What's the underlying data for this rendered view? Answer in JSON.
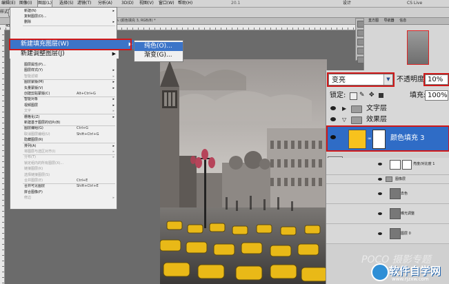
{
  "menubar": {
    "items": [
      "编辑(E)",
      "图像(I)",
      "图层(L)",
      "选择(S)",
      "滤镜(T)",
      "分析(A)",
      "3D(D)",
      "视图(V)",
      "窗口(W)",
      "帮助(H)"
    ],
    "zoom": "20.1",
    "workspace": "设计",
    "cslive": "CS Live"
  },
  "optionbar": {
    "label": "样式:",
    "style_value": "细"
  },
  "doc_tab": "@ 20.1% (颜色填充 3, RGB/8) *",
  "ruler_nums": [
    "40",
    "6"
  ],
  "layer_menu": {
    "items": [
      {
        "label": "新建(N)",
        "key": "",
        "arrow": true,
        "disabled": false
      },
      {
        "label": "复制图层(D)...",
        "key": "",
        "arrow": false,
        "disabled": false
      },
      {
        "label": "删除",
        "key": "",
        "arrow": true,
        "disabled": false
      },
      {
        "label": "图层属性(P)...",
        "key": "",
        "arrow": false,
        "disabled": false
      },
      {
        "label": "图层样式(Y)",
        "key": "",
        "arrow": true,
        "disabled": false
      },
      {
        "label": "智能滤镜",
        "key": "",
        "arrow": true,
        "disabled": true
      },
      {
        "label": "图层蒙版(M)",
        "key": "",
        "arrow": true,
        "disabled": false
      },
      {
        "label": "矢量蒙版(V)",
        "key": "",
        "arrow": true,
        "disabled": false
      },
      {
        "label": "创建剪贴蒙版(C)",
        "key": "Alt+Ctrl+G",
        "arrow": false,
        "disabled": false
      },
      {
        "label": "智能对象",
        "key": "",
        "arrow": true,
        "disabled": false
      },
      {
        "label": "视频图层",
        "key": "",
        "arrow": true,
        "disabled": false
      },
      {
        "label": "文字",
        "key": "",
        "arrow": true,
        "disabled": true
      },
      {
        "label": "栅格化(Z)",
        "key": "",
        "arrow": true,
        "disabled": false
      },
      {
        "label": "新建基于图层的切片(B)",
        "key": "",
        "arrow": false,
        "disabled": false
      },
      {
        "label": "图层编组(G)",
        "key": "Ctrl+G",
        "arrow": false,
        "disabled": false
      },
      {
        "label": "取消图层编组(U)",
        "key": "Shift+Ctrl+G",
        "arrow": false,
        "disabled": true
      },
      {
        "label": "隐藏图层(R)",
        "key": "",
        "arrow": false,
        "disabled": false
      },
      {
        "label": "排列(A)",
        "key": "",
        "arrow": true,
        "disabled": false
      },
      {
        "label": "将图层与选区对齐(I)",
        "key": "",
        "arrow": true,
        "disabled": true
      },
      {
        "label": "分布(T)",
        "key": "",
        "arrow": true,
        "disabled": true
      },
      {
        "label": "锁定组内的所有图层(X)...",
        "key": "",
        "arrow": false,
        "disabled": true
      },
      {
        "label": "链接图层(K)",
        "key": "",
        "arrow": false,
        "disabled": true
      },
      {
        "label": "选择链接图层(S)",
        "key": "",
        "arrow": false,
        "disabled": true
      },
      {
        "label": "合并图层(E)",
        "key": "Ctrl+E",
        "arrow": false,
        "disabled": true
      },
      {
        "label": "合并可见图层",
        "key": "Shift+Ctrl+E",
        "arrow": false,
        "disabled": false
      },
      {
        "label": "拼合图像(F)",
        "key": "",
        "arrow": false,
        "disabled": false
      },
      {
        "label": "修边",
        "key": "",
        "arrow": true,
        "disabled": true
      }
    ],
    "highlighted": "新建填充图层(W)",
    "adjust": "新建调整图层(J)"
  },
  "fill_submenu": [
    "纯色(O)...",
    "渐变(G)..."
  ],
  "navigator": {
    "tabs": [
      "直方图",
      "导航器",
      "信息"
    ]
  },
  "layers_panel": {
    "blend_mode": "变亮",
    "opacity_label": "不透明度:",
    "opacity_value": "10%",
    "lock_label": "锁定:",
    "fill_label": "填充:",
    "fill_value": "100%",
    "groups": [
      "文字层",
      "效果层"
    ],
    "selected_layer": "颜色填充 3",
    "sub_layers": [
      "亮度/对比度 1",
      "图像层",
      "去色",
      "曝光调整",
      "图层 0"
    ]
  },
  "watermark": {
    "poco": "POCO 摄影专题",
    "site_cn": "软件自学网",
    "site_url": "www.rjzxw.com"
  },
  "colors": {
    "highlight": "#3c74c8",
    "red_box": "#d01818",
    "fill_swatch": "#f7c21d"
  }
}
